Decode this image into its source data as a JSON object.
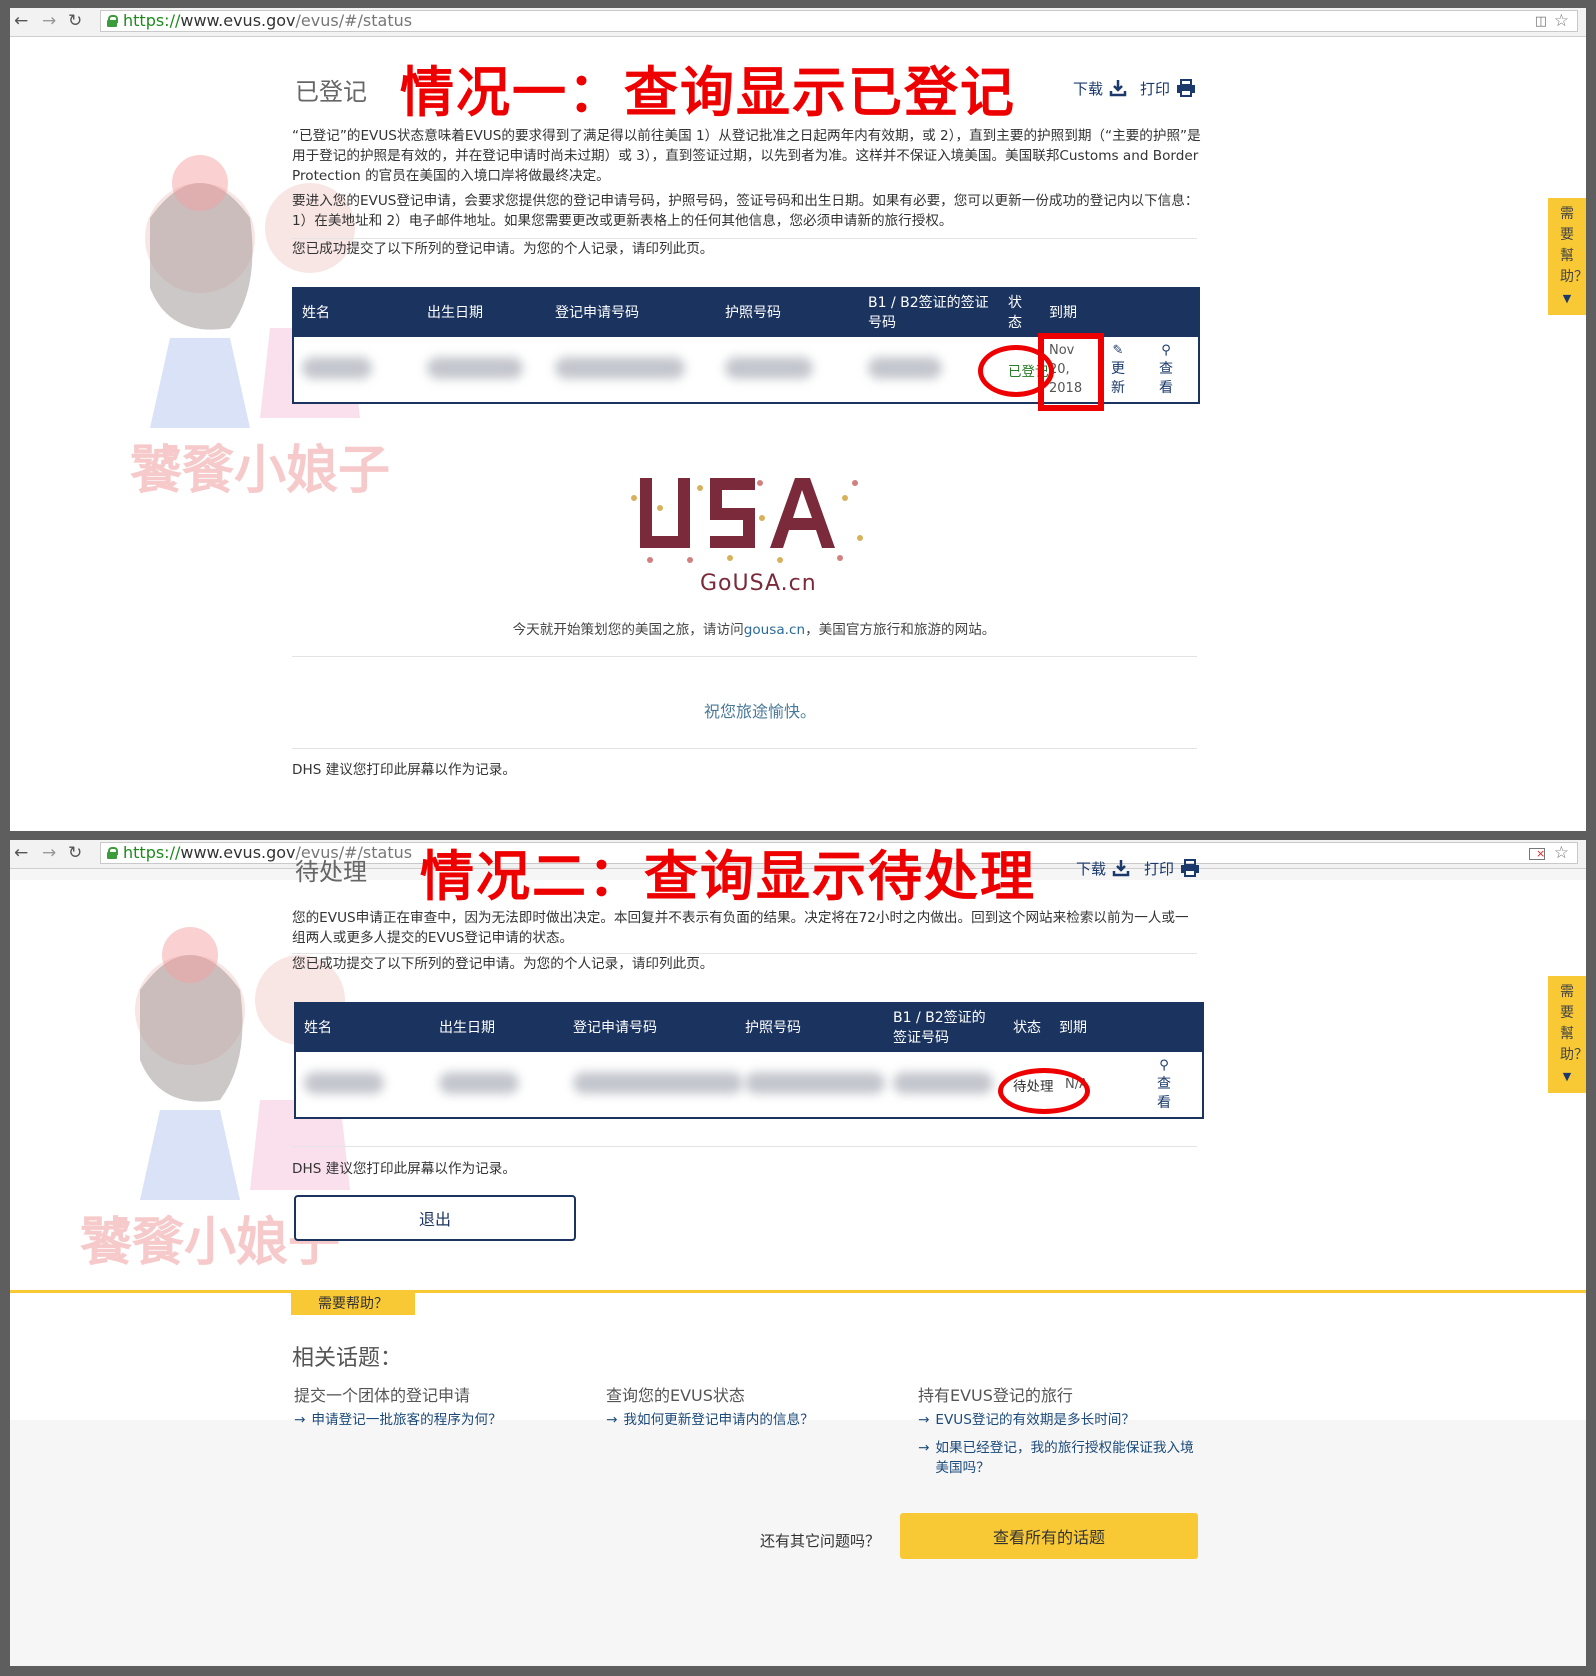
{
  "browser": {
    "url_scheme": "https://",
    "url_host": "www.evus.gov",
    "url_path": "/evus/#/status"
  },
  "case1": {
    "page_title": "已登记",
    "annotation": "情况一：查询显示已登记",
    "download_label": "下载",
    "print_label": "打印",
    "para1": "“已登记”的EVUS状态意味着EVUS的要求得到了满足得以前往美国 1）从登记批准之日起两年内有效期，或 2），直到主要的护照到期（“主要的护照”是用于登记的护照是有效的，并在登记申请时尚未过期）或 3），直到签证过期，以先到者为准。这样并不保证入境美国。美国联邦Customs and Border Protection 的官员在美国的入境口岸将做最终决定。",
    "para2": "要进入您的EVUS登记申请，会要求您提供您的登记申请号码，护照号码，签证号码和出生日期。如果有必要，您可以更新一份成功的登记内以下信息：1）在美地址和 2）电子邮件地址。如果您需要更改或更新表格上的任何其他信息，您必须申请新的旅行授权。",
    "para3": "您已成功提交了以下所列的登记申请。为您的个人记录，请印列此页。",
    "table_headers": [
      "姓名",
      "出生日期",
      "登记申请号码",
      "护照号码",
      "B1 / B2签证的签证号码",
      "状态",
      "到期"
    ],
    "row_status": "已登记",
    "row_expiry": "Nov 20, 2018",
    "action_update": "更新",
    "action_view": "查看",
    "gousa_label": "GoUSA.cn",
    "plan_text_1": "今天就开始策划您的美国之旅，请访问",
    "plan_link": "gousa.cn",
    "plan_text_2": "，美国官方旅行和旅游的网站。",
    "wish": "祝您旅途愉快。",
    "dhs_note": "DHS 建议您打印此屏幕以作为记录。",
    "help_tab": "需要幫助？"
  },
  "case2": {
    "page_title": "待处理",
    "annotation": "情况二：查询显示待处理",
    "download_label": "下载",
    "print_label": "打印",
    "para1": "您的EVUS申请正在审查中，因为无法即时做出决定。本回复并不表示有负面的结果。决定将在72小时之内做出。回到这个网站来检索以前为一人或一组两人或更多人提交的EVUS登记申请的状态。",
    "para2": "您已成功提交了以下所列的登记申请。为您的个人记录，请印列此页。",
    "table_headers": [
      "姓名",
      "出生日期",
      "登记申请号码",
      "护照号码",
      "B1 / B2签证的签证号码",
      "状态",
      "到期"
    ],
    "row_status": "待处理",
    "row_expiry": "N/A",
    "action_view": "查看",
    "dhs_note": "DHS 建议您打印此屏幕以作为记录。",
    "exit_button": "退出",
    "help_tab": "需要幫助？",
    "footer_tab": "需要帮助？",
    "related_title": "相关话题：",
    "columns": [
      {
        "title": "提交一个团体的登记申请",
        "links": [
          "申请登记一批旅客的程序为何？"
        ]
      },
      {
        "title": "查询您的EVUS状态",
        "links": [
          "我如何更新登记申请内的信息？"
        ]
      },
      {
        "title": "持有EVUS登记的旅行",
        "links": [
          "EVUS登记的有效期是多长时间？",
          "如果已经登记，我的旅行授权能保证我入境美国吗？"
        ]
      }
    ],
    "other_questions": "还有其它问题吗？",
    "view_all_button": "查看所有的话题"
  },
  "colors": {
    "navy": "#1b335f",
    "annotation_red": "#e00000",
    "help_yellow": "#f8c935",
    "registered_green": "#2a7a2a"
  }
}
